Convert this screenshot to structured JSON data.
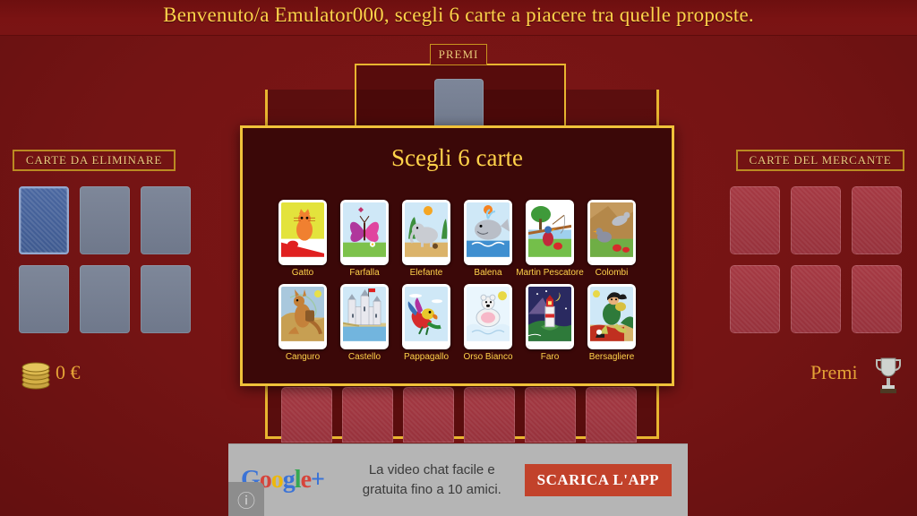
{
  "header": {
    "welcome_message": "Benvenuto/a Emulator000, scegli 6 carte a piacere tra quelle proposte."
  },
  "prizes_frame": {
    "tab_label": "PREMI"
  },
  "left_panel": {
    "title": "CARTE DA ELIMINARE",
    "slots": [
      {
        "state": "back-blue"
      },
      {
        "state": "empty"
      },
      {
        "state": "empty"
      },
      {
        "state": "empty"
      },
      {
        "state": "empty"
      },
      {
        "state": "empty"
      }
    ],
    "money_value": "0 €"
  },
  "right_panel": {
    "title": "CARTE DEL MERCANTE",
    "slots": [
      {
        "state": "back-red"
      },
      {
        "state": "back-red"
      },
      {
        "state": "back-red"
      },
      {
        "state": "back-red"
      },
      {
        "state": "back-red"
      },
      {
        "state": "back-red"
      }
    ],
    "prizes_label": "Premi"
  },
  "hand_row": {
    "count": 6
  },
  "dialog": {
    "title": "Scegli 6 carte",
    "rows": [
      [
        {
          "label": "Gatto",
          "art": "gatto"
        },
        {
          "label": "Farfalla",
          "art": "farfalla"
        },
        {
          "label": "Elefante",
          "art": "elefante"
        },
        {
          "label": "Balena",
          "art": "balena"
        },
        {
          "label": "Martin Pescatore",
          "art": "martin"
        },
        {
          "label": "Colombi",
          "art": "colombi"
        }
      ],
      [
        {
          "label": "Canguro",
          "art": "canguro"
        },
        {
          "label": "Castello",
          "art": "castello"
        },
        {
          "label": "Pappagallo",
          "art": "pappagallo"
        },
        {
          "label": "Orso Bianco",
          "art": "orso"
        },
        {
          "label": "Faro",
          "art": "faro"
        },
        {
          "label": "Bersagliere",
          "art": "bersagliere"
        }
      ]
    ]
  },
  "ad": {
    "logo_text": "Google+",
    "body_line1": "La video chat facile e",
    "body_line2": "gratuita fino a 10 amici.",
    "cta_label": "SCARICA L'APP",
    "info_icon": "info-icon"
  },
  "colors": {
    "background_red": "#7a1414",
    "gold": "#e8b530",
    "title_yellow": "#ffd24a",
    "dialog_bg": "#3b0808",
    "amber_text": "#e4a236"
  }
}
